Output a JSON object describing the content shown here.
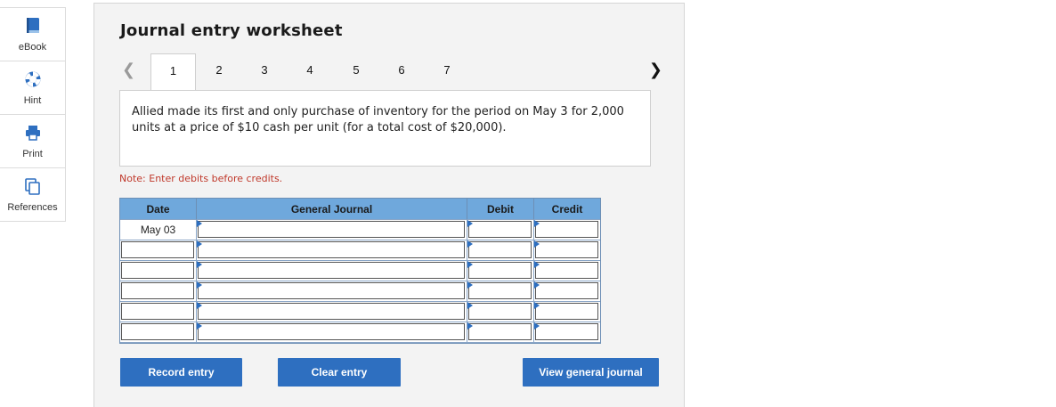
{
  "sidebar": {
    "items": [
      {
        "label": "eBook",
        "icon": "book-icon"
      },
      {
        "label": "Hint",
        "icon": "lifebuoy-icon"
      },
      {
        "label": "Print",
        "icon": "printer-icon"
      },
      {
        "label": "References",
        "icon": "documents-icon"
      }
    ]
  },
  "worksheet": {
    "title": "Journal entry worksheet",
    "pages": [
      "1",
      "2",
      "3",
      "4",
      "5",
      "6",
      "7"
    ],
    "active_page": "1",
    "description": "Allied made its first and only purchase of inventory for the period on May 3 for 2,000 units at a price of $10 cash per unit (for a total cost of $20,000).",
    "note": "Note: Enter debits before credits."
  },
  "journal": {
    "headers": {
      "date": "Date",
      "account": "General Journal",
      "debit": "Debit",
      "credit": "Credit"
    },
    "rows": [
      {
        "date": "May 03",
        "account": "",
        "debit": "",
        "credit": ""
      },
      {
        "date": "",
        "account": "",
        "debit": "",
        "credit": ""
      },
      {
        "date": "",
        "account": "",
        "debit": "",
        "credit": ""
      },
      {
        "date": "",
        "account": "",
        "debit": "",
        "credit": ""
      },
      {
        "date": "",
        "account": "",
        "debit": "",
        "credit": ""
      },
      {
        "date": "",
        "account": "",
        "debit": "",
        "credit": ""
      }
    ]
  },
  "buttons": {
    "record": "Record entry",
    "clear": "Clear entry",
    "view": "View general journal"
  },
  "colors": {
    "accent": "#2e6fc0",
    "header_bg": "#6fa8dc",
    "note": "#c0392b"
  }
}
